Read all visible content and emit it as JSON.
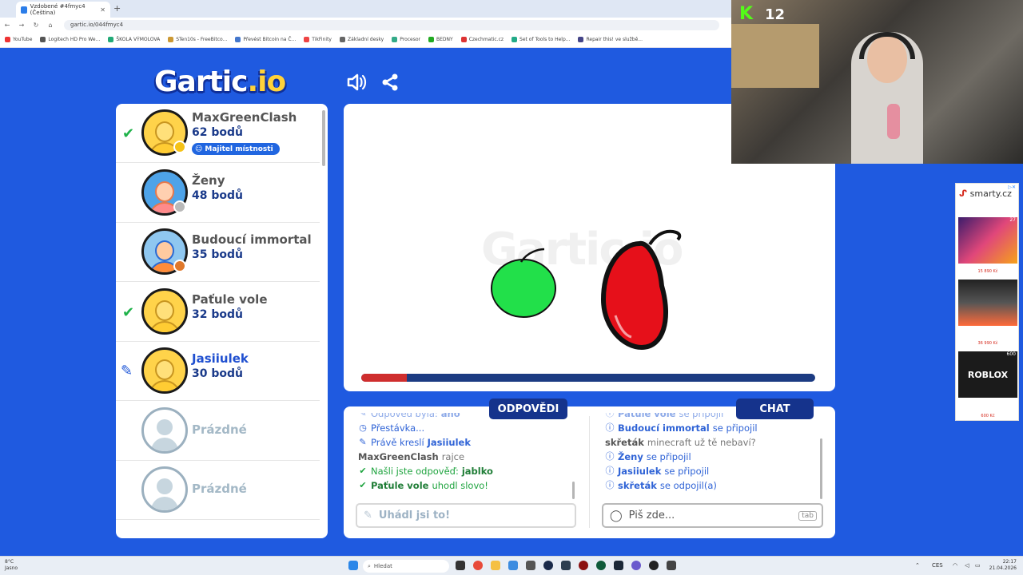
{
  "browser": {
    "tab_title": "Vzdobené #4fmyc4 (Čeština)",
    "url": "gartic.io/044fmyc4",
    "bookmarks": [
      "YouTube",
      "Logitech HD Pro We...",
      "ŠKOLA VÝMOLOVA",
      "STen10s - FreeBitco...",
      "Převést Bitcoin na Č...",
      "TikFinity",
      "Základní desky",
      "Procesor",
      "BEDNY",
      "Czechmatic.cz",
      "Set of Tools to Help...",
      "Repair this! ve službě..."
    ]
  },
  "header": {
    "logo_main": "Gartic",
    "logo_suffix": ".io",
    "sound_icon": "speaker-icon",
    "share_icon": "share-icon"
  },
  "players": [
    {
      "name": "MaxGreenClash",
      "score": "62 bodů",
      "badge": "Majitel místnosti",
      "status": "guessed",
      "avatar": "yellow",
      "dot_color": "#f5c216"
    },
    {
      "name": "Ženy",
      "score": "48 bodů",
      "status": "",
      "avatar": "girl1",
      "dot_color": "#b9b9b9"
    },
    {
      "name": "Budoucí immortal",
      "score": "35 bodů",
      "status": "",
      "avatar": "girl2",
      "dot_color": "#e0782a"
    },
    {
      "name": "Paťule vole",
      "score": "32 bodů",
      "status": "guessed",
      "avatar": "yellow"
    },
    {
      "name": "Jasiiulek",
      "score": "30 bodů",
      "status": "drawing",
      "avatar": "yellow"
    },
    {
      "name": "Prázdné",
      "score": "",
      "status": "",
      "avatar": "empty"
    },
    {
      "name": "Prázdné",
      "score": "",
      "status": "",
      "avatar": "empty"
    }
  ],
  "canvas": {
    "watermark": "Gartic.io",
    "timer_progress": 0.1,
    "timer_fill_color": "#cf2e2e",
    "timer_track_color": "#1c3b82"
  },
  "answers": {
    "tab_label": "ODPOVĚDI",
    "cut_line": {
      "prefix": "Odpověď byla:",
      "word": "ano"
    },
    "lines": [
      {
        "icon": "clock-icon",
        "text": "Přestávka...",
        "bold": ""
      },
      {
        "icon": "pencil-icon",
        "text": "Právě kreslí",
        "bold": "Jasiiulek"
      },
      {
        "user": "MaxGreenClash",
        "message": "rajce"
      },
      {
        "icon": "check-icon",
        "text": "Našli jste odpověď:",
        "bold": "jablko"
      },
      {
        "icon": "check-icon",
        "bold_first": "Paťule vole",
        "text": "uhodl slovo!"
      }
    ],
    "input_placeholder": "Uhádl jsi to!"
  },
  "chat": {
    "tab_label": "CHAT",
    "cut_line": {
      "user": "Paťule vole",
      "text": "se připojil"
    },
    "lines": [
      {
        "icon": "info-icon",
        "user": "Budoucí immortal",
        "text": "se připojil"
      },
      {
        "user": "skřeták",
        "message": "minecraft už tě nebaví?"
      },
      {
        "icon": "info-icon",
        "user": "Ženy",
        "text": "se připojil"
      },
      {
        "icon": "info-icon",
        "user": "Jasiiulek",
        "text": "se připojil"
      },
      {
        "icon": "info-icon",
        "user": "skřeták",
        "text": "se odpojil(a)"
      }
    ],
    "input_placeholder": "Piš zde...",
    "tab_hint": "tab"
  },
  "stream": {
    "platform_logo": "K",
    "viewer_count": "12"
  },
  "ad": {
    "brand": "smarty.cz",
    "items": [
      {
        "price": "15 890 Kč",
        "label": "27"
      },
      {
        "price": "36 990 Kč",
        "label": ""
      },
      {
        "price": "600 Kč",
        "label": "ROBLOX",
        "corner": "600"
      }
    ]
  },
  "taskbar": {
    "weather_temp": "8°C",
    "weather_text": "Jasno",
    "search_placeholder": "Hledat",
    "lang": "CES",
    "time": "22:17",
    "date": "21.04.2026"
  }
}
